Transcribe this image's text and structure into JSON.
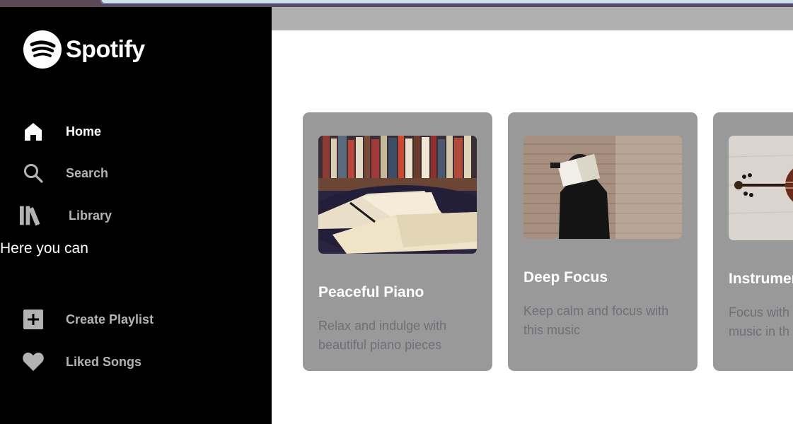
{
  "brand": {
    "name": "Spotify",
    "color": "#ffffff"
  },
  "sidebar": {
    "background": "#000000",
    "items": [
      {
        "label": "Home",
        "icon": "home-icon",
        "active": true
      },
      {
        "label": "Search",
        "icon": "search-icon"
      },
      {
        "label": "Library",
        "icon": "library-icon"
      },
      {
        "label": "Create Playlist",
        "icon": "plus-square-icon"
      },
      {
        "label": "Liked Songs",
        "icon": "heart-icon"
      }
    ],
    "note": "Here you can"
  },
  "main": {
    "header_color": "#b0b0b0",
    "cards": [
      {
        "title": "Peaceful Piano",
        "description": "Relax and indulge with beautiful piano pieces",
        "image": "open-books-on-table-image"
      },
      {
        "title": "Deep Focus",
        "description": "Keep calm and focus with this music",
        "image": "person-with-book-on-face-image"
      },
      {
        "title": "Instrumer",
        "description": "Focus with\nmusic in th",
        "image": "violin-image"
      }
    ]
  },
  "colors": {
    "card_bg": "#999999",
    "card_desc": "#6f6f77",
    "nav_inactive": "#b3b3b3"
  }
}
